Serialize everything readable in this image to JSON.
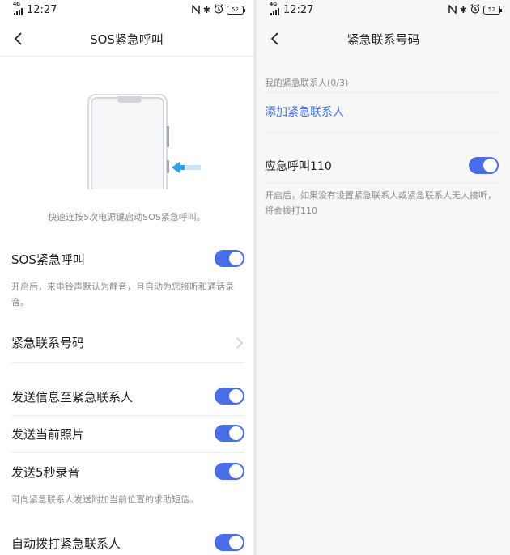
{
  "status_bar": {
    "time": "12:27",
    "network": "4G",
    "battery": "52",
    "bluetooth": "✱"
  },
  "left_screen": {
    "title": "SOS紧急呼叫",
    "illustration_caption": "快速连按5次电源键启动SOS紧急呼叫。",
    "sos_toggle_label": "SOS紧急呼叫",
    "sos_toggle_on": true,
    "sos_description": "开启后，来电铃声默认为静音，且自动为您接听和通话录音。",
    "emergency_numbers_label": "紧急联系号码",
    "send_message_label": "发送信息至紧急联系人",
    "send_message_on": true,
    "send_photo_label": "发送当前照片",
    "send_photo_on": true,
    "send_audio_label": "发送5秒录音",
    "send_audio_on": true,
    "send_description": "可向紧急联系人发送附加当前位置的求助短信。",
    "auto_dial_label": "自动拨打紧急联系人",
    "auto_dial_on": true
  },
  "right_screen": {
    "title": "紧急联系号码",
    "contacts_header": "我的紧急联系人(0/3)",
    "add_contact_label": "添加紧急联系人",
    "call_110_label": "应急呼叫110",
    "call_110_on": true,
    "call_110_description": "开启后，如果没有设置紧急联系人或紧急联系人无人接听，将会拨打110"
  },
  "colors": {
    "accent": "#4a6ee8",
    "link": "#3d6fe0",
    "arrow": "#2a9df4"
  }
}
